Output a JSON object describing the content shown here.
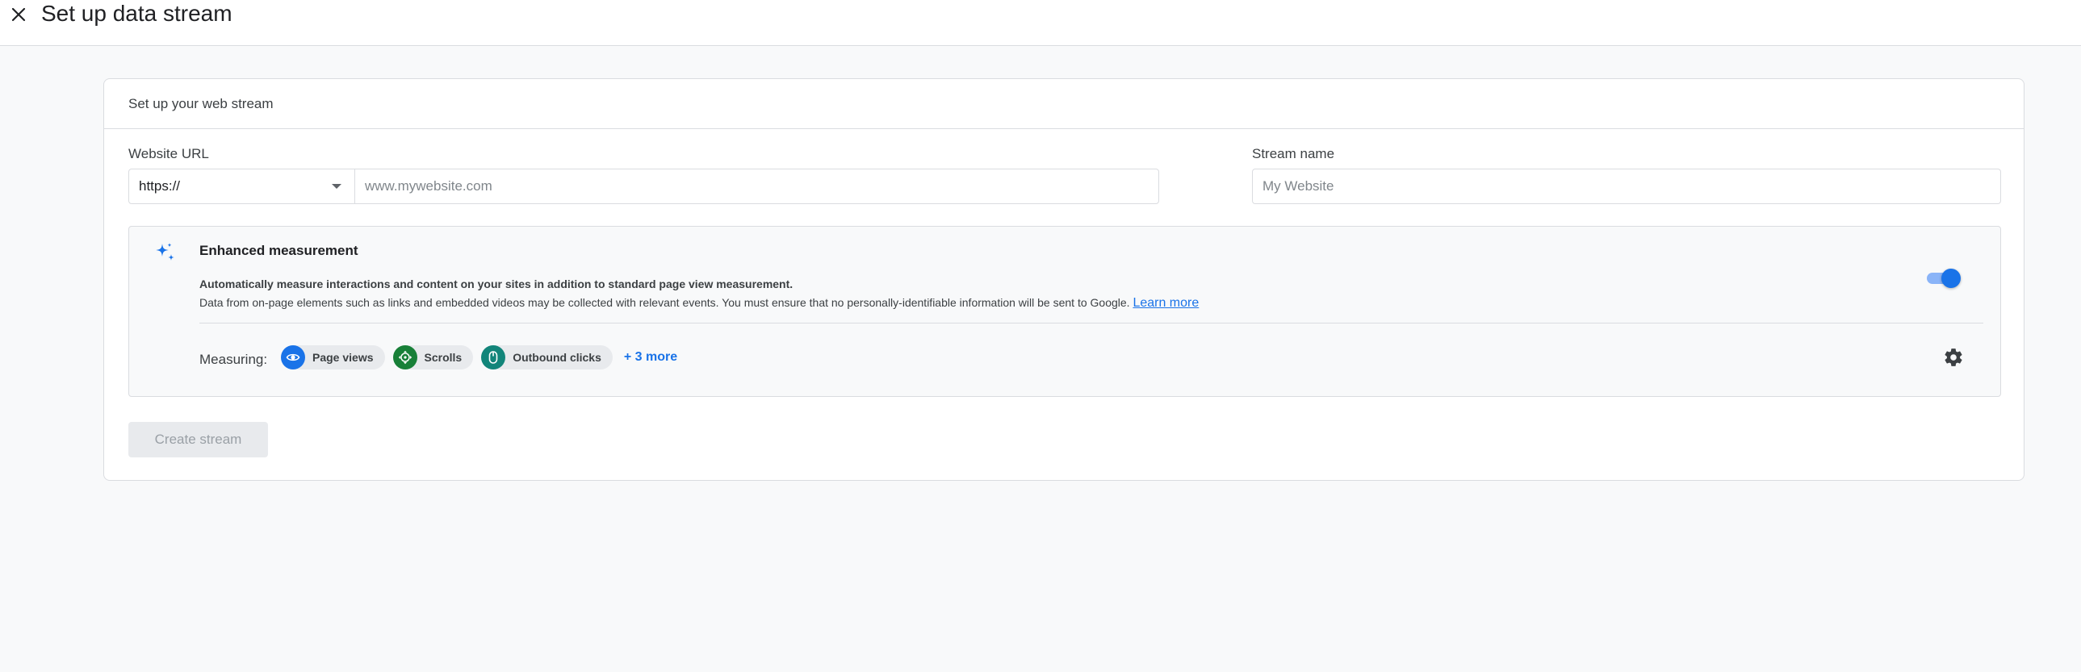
{
  "header": {
    "title": "Set up data stream"
  },
  "card": {
    "title": "Set up your web stream",
    "website_url": {
      "label": "Website URL",
      "protocol": "https://",
      "placeholder": "www.mywebsite.com",
      "value": ""
    },
    "stream_name": {
      "label": "Stream name",
      "placeholder": "My Website",
      "value": ""
    },
    "enhanced_measurement": {
      "title": "Enhanced measurement",
      "description_bold": "Automatically measure interactions and content on your sites in addition to standard page view measurement.",
      "description": "Data from on-page elements such as links and embedded videos may be collected with relevant events. You must ensure that no personally-identifiable information will be sent to Google.",
      "learn_more": "Learn more",
      "enabled": true,
      "measuring_label": "Measuring:",
      "chips": [
        {
          "label": "Page views",
          "icon": "eye-icon",
          "color": "#1a73e8"
        },
        {
          "label": "Scrolls",
          "icon": "scroll-icon",
          "color": "#188038"
        },
        {
          "label": "Outbound clicks",
          "icon": "mouse-icon",
          "color": "#12857a"
        }
      ],
      "more": "+ 3 more"
    },
    "create_button": "Create stream"
  },
  "colors": {
    "accent": "#1a73e8",
    "toggle_track": "#8ab4f8",
    "disabled_button_bg": "#e8eaed",
    "disabled_button_text": "#9aa0a6"
  }
}
